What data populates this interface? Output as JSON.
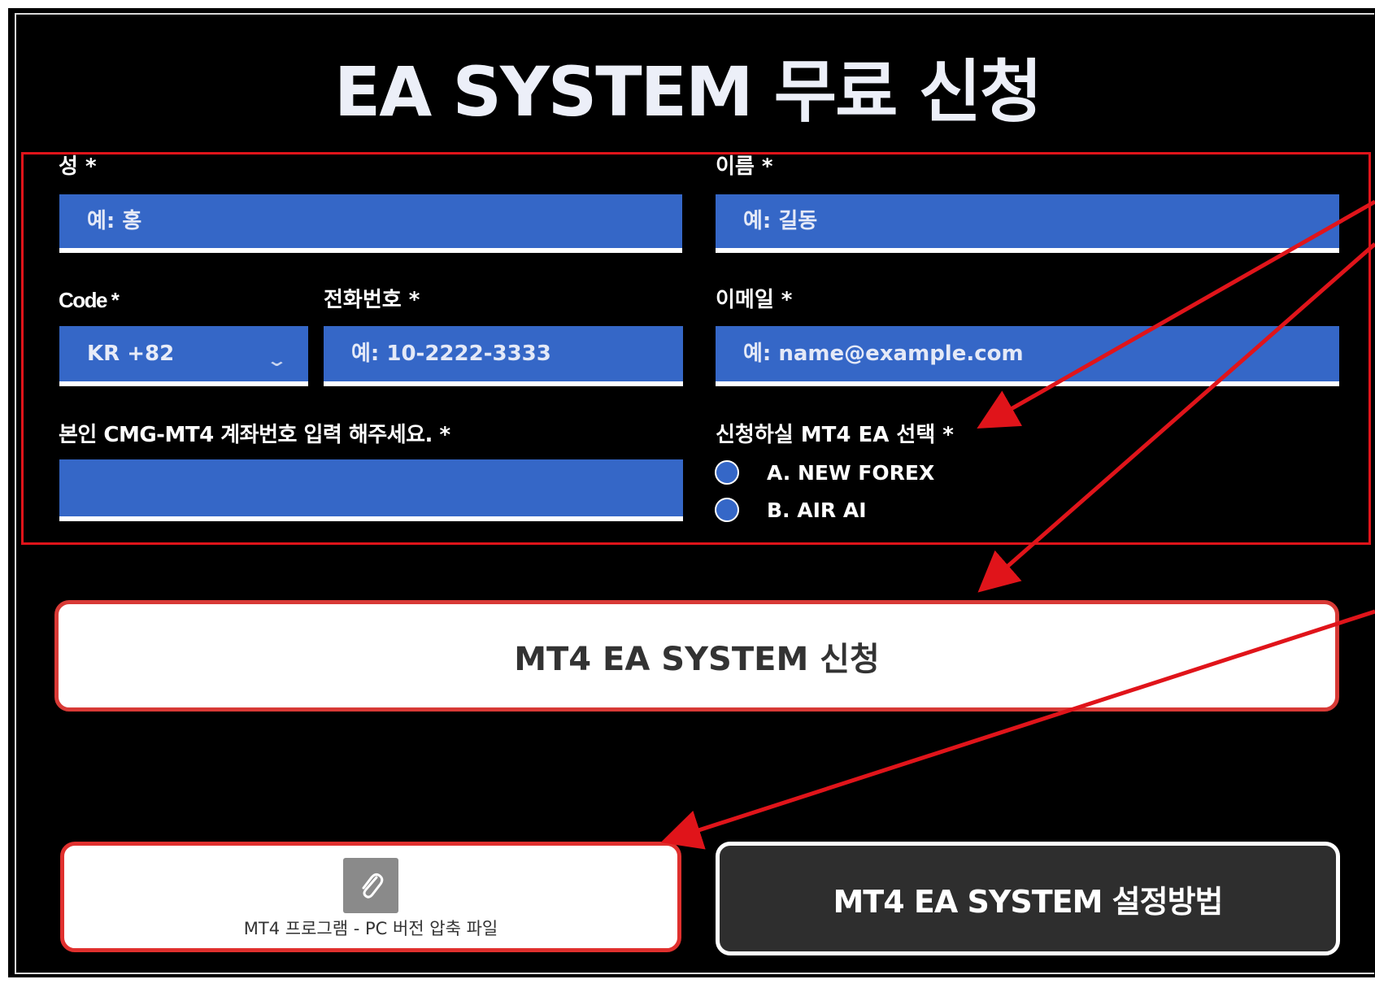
{
  "page": {
    "title": "EA SYSTEM 무료 신청"
  },
  "form": {
    "last_name": {
      "label": "성 *",
      "placeholder": "예: 홍"
    },
    "first_name": {
      "label": "이름 *",
      "placeholder": "예: 길동"
    },
    "code": {
      "label": "Code *",
      "value": "KR +82"
    },
    "phone": {
      "label": "전화번호 *",
      "placeholder": "예: 10-2222-3333"
    },
    "email": {
      "label": "이메일 *",
      "placeholder": "예: name@example.com"
    },
    "account": {
      "label": "본인 CMG-MT4 계좌번호 입력 해주세요. *",
      "value": ""
    },
    "ea_choice": {
      "label": "신청하실 MT4 EA 선택 *",
      "options": [
        "A. NEW FOREX",
        "B. AIR AI"
      ]
    }
  },
  "buttons": {
    "submit": "MT4 EA SYSTEM 신청",
    "file_download": "MT4 프로그램 - PC 버전 압축 파일",
    "setup_guide": "MT4 EA SYSTEM 설정방법"
  },
  "colors": {
    "field_bg": "#3567c7",
    "annotation_red": "#e0141a",
    "page_bg": "#000000"
  }
}
